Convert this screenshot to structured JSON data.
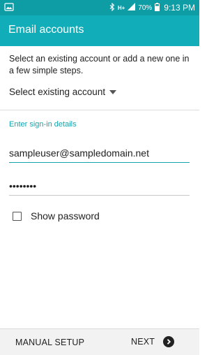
{
  "colors": {
    "status_bar": "#0e9ca5",
    "app_bar": "#11adb8",
    "accent": "#12a4ad",
    "bottom_bar": "#f2f2f2"
  },
  "status_bar": {
    "battery_percent": "70%",
    "time": "9:13 PM",
    "network_label": "H+",
    "icons": [
      "image-icon",
      "bluetooth-icon",
      "network-h-icon",
      "signal-icon",
      "battery-icon"
    ]
  },
  "app_bar": {
    "title": "Email accounts"
  },
  "intro": {
    "text": "Select an existing account or add a new one in a few simple steps."
  },
  "existing_account": {
    "label": "Select existing account",
    "icon": "dropdown-caret-icon"
  },
  "sign_in": {
    "section_label": "Enter sign-in details",
    "email_value": "sampleuser@sampledomain.net",
    "password_value": "••••••••",
    "show_password_label": "Show password",
    "show_password_checked": false
  },
  "bottom_bar": {
    "manual_setup_label": "MANUAL SETUP",
    "next_label": "NEXT",
    "next_icon": "chevron-right-circle-icon"
  }
}
